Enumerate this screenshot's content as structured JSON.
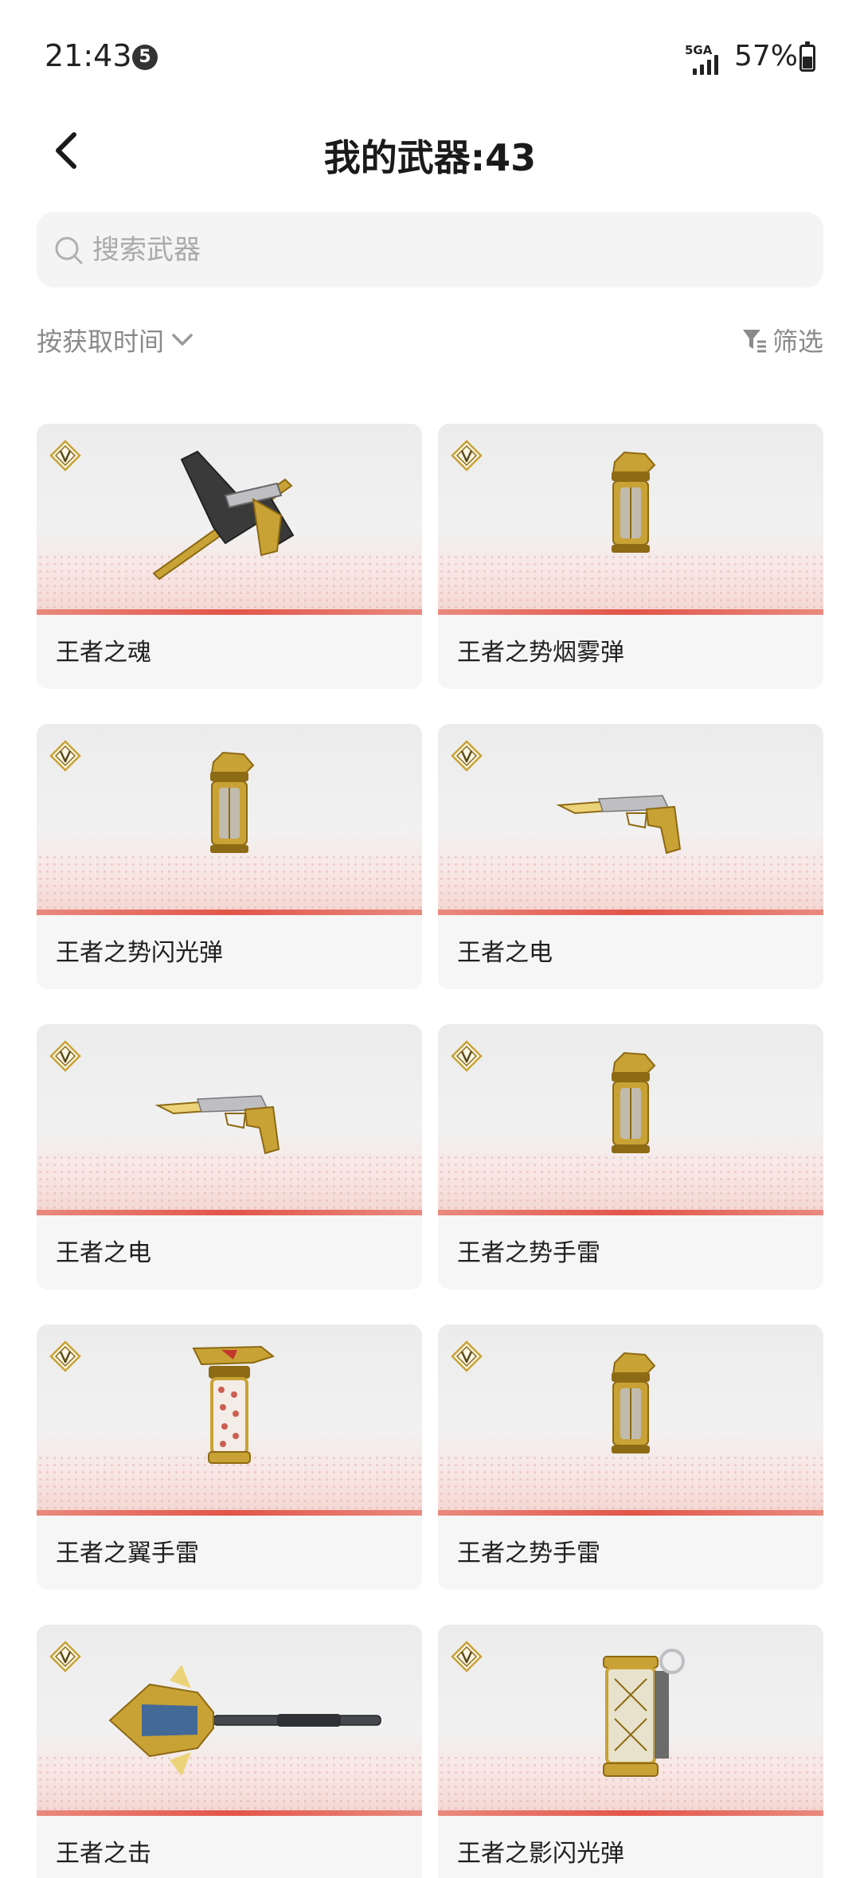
{
  "status_bar": {
    "time": "21:43",
    "notification_count": "5",
    "network_label": "5GA",
    "battery": "57%"
  },
  "header": {
    "title": "我的武器:43"
  },
  "search": {
    "placeholder": "搜索武器"
  },
  "controls": {
    "sort_label": "按获取时间",
    "filter_label": "筛选"
  },
  "weapons": [
    {
      "name": "王者之魂",
      "icon": "crossed-pistol-blade-icon"
    },
    {
      "name": "王者之势烟雾弹",
      "icon": "grenade-canister-icon"
    },
    {
      "name": "王者之势闪光弹",
      "icon": "grenade-canister-icon"
    },
    {
      "name": "王者之电",
      "icon": "golden-pistol-icon"
    },
    {
      "name": "王者之电",
      "icon": "golden-pistol-icon"
    },
    {
      "name": "王者之势手雷",
      "icon": "grenade-canister-icon"
    },
    {
      "name": "王者之翼手雷",
      "icon": "dragon-grenade-icon"
    },
    {
      "name": "王者之势手雷",
      "icon": "grenade-canister-icon"
    },
    {
      "name": "王者之击",
      "icon": "warhammer-icon"
    },
    {
      "name": "王者之影闪光弹",
      "icon": "flashbang-icon"
    }
  ],
  "colors": {
    "accent_red": "#e2554a",
    "gold": "#c9a235",
    "card_bg": "#f6f6f6"
  }
}
